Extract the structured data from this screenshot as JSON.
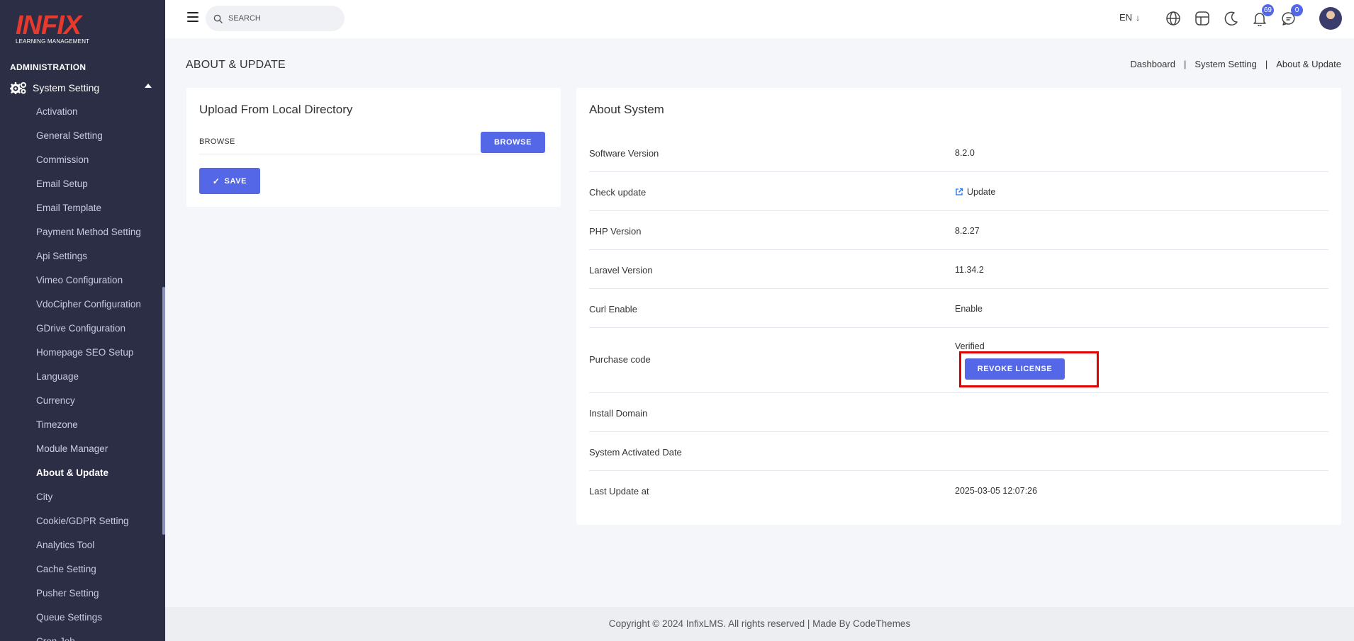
{
  "brand": {
    "logo_text": "INFIX",
    "logo_subtitle": "LEARNING MANAGEMENT"
  },
  "sidebar": {
    "section_label": "ADMINISTRATION",
    "group_label": "System Setting",
    "group_icon": "gears-icon",
    "items": [
      {
        "label": "Activation",
        "active": false
      },
      {
        "label": "General Setting",
        "active": false
      },
      {
        "label": "Commission",
        "active": false
      },
      {
        "label": "Email Setup",
        "active": false
      },
      {
        "label": "Email Template",
        "active": false
      },
      {
        "label": "Payment Method Setting",
        "active": false
      },
      {
        "label": "Api Settings",
        "active": false
      },
      {
        "label": "Vimeo Configuration",
        "active": false
      },
      {
        "label": "VdoCipher Configuration",
        "active": false
      },
      {
        "label": "GDrive Configuration",
        "active": false
      },
      {
        "label": "Homepage SEO Setup",
        "active": false
      },
      {
        "label": "Language",
        "active": false
      },
      {
        "label": "Currency",
        "active": false
      },
      {
        "label": "Timezone",
        "active": false
      },
      {
        "label": "Module Manager",
        "active": false
      },
      {
        "label": "About & Update",
        "active": true
      },
      {
        "label": "City",
        "active": false
      },
      {
        "label": "Cookie/GDPR Setting",
        "active": false
      },
      {
        "label": "Analytics Tool",
        "active": false
      },
      {
        "label": "Cache Setting",
        "active": false
      },
      {
        "label": "Pusher Setting",
        "active": false
      },
      {
        "label": "Queue Settings",
        "active": false
      },
      {
        "label": "Cron Job",
        "active": false
      }
    ]
  },
  "topbar": {
    "search_placeholder": "SEARCH",
    "language": "EN",
    "language_arrow": "↓",
    "notifications_count": "69",
    "messages_count": "0"
  },
  "page": {
    "title": "ABOUT & UPDATE",
    "breadcrumb": [
      "Dashboard",
      "System Setting",
      "About & Update"
    ],
    "breadcrumb_sep": "|"
  },
  "upload": {
    "title": "Upload From Local Directory",
    "browse_label": "BROWSE",
    "browse_button": "BROWSE",
    "save_check": "✓",
    "save_button": "SAVE"
  },
  "about": {
    "title": "About System",
    "rows": {
      "software_version": {
        "label": "Software Version",
        "value": "8.2.0"
      },
      "check_update": {
        "label": "Check update",
        "value": "Update"
      },
      "php_version": {
        "label": "PHP Version",
        "value": "8.2.27"
      },
      "laravel_version": {
        "label": "Laravel Version",
        "value": "11.34.2"
      },
      "curl_enable": {
        "label": "Curl Enable",
        "value": "Enable"
      },
      "purchase_code": {
        "label": "Purchase code",
        "value": "Verified",
        "button": "REVOKE LICENSE"
      },
      "install_domain": {
        "label": "Install Domain",
        "value": ""
      },
      "system_activated_date": {
        "label": "System Activated Date",
        "value": ""
      },
      "last_update_at": {
        "label": "Last Update at",
        "value": "2025-03-05 12:07:26"
      }
    }
  },
  "footer": {
    "text": "Copyright © 2024 InfixLMS. All rights reserved | Made By CodeThemes"
  },
  "colors": {
    "sidebar_bg": "#2b2e45",
    "accent": "#5468e7",
    "link": "#1a73e8",
    "highlight": "#e00000",
    "logo_red": "#e8392d"
  }
}
